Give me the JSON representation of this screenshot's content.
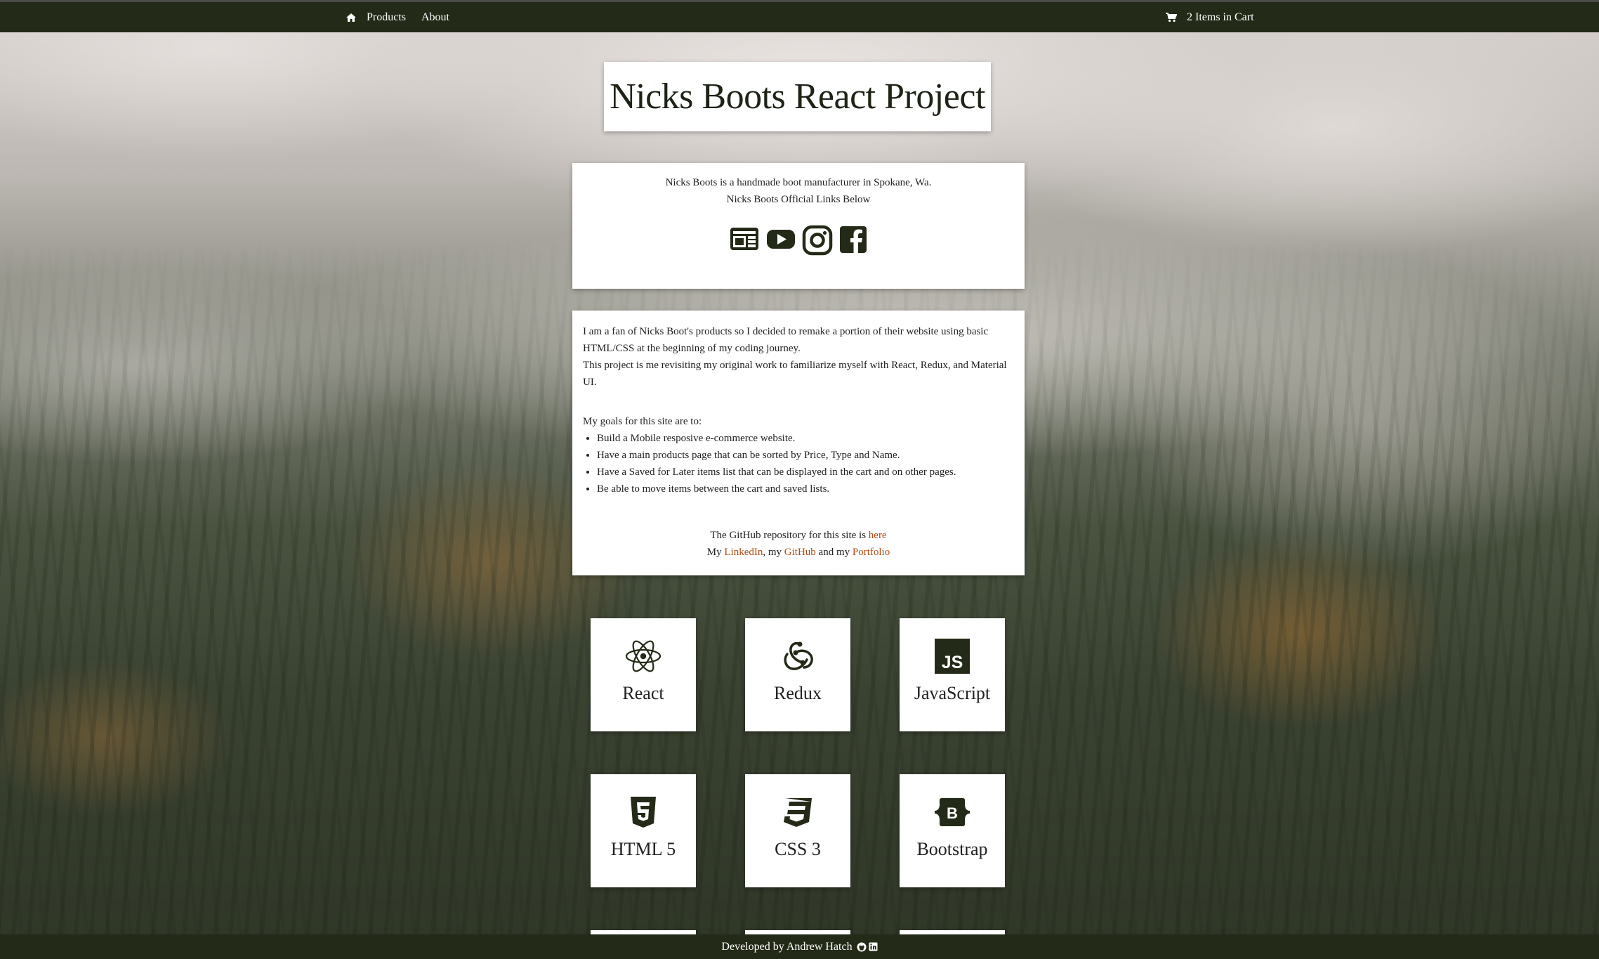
{
  "nav": {
    "home_icon": "home-icon",
    "items": [
      {
        "label": "Products"
      },
      {
        "label": "About"
      }
    ],
    "cart_icon": "shopping-cart-icon",
    "cart_label": "2 Items in Cart"
  },
  "header": {
    "title": "Nicks Boots React Project"
  },
  "intro": {
    "line1": "Nicks Boots is a handmade boot manufacturer in Spokane, Wa.",
    "line2": "Nicks Boots Official Links Below",
    "social_icons": [
      "website-icon",
      "youtube-icon",
      "instagram-icon",
      "facebook-icon"
    ]
  },
  "about": {
    "para1": "I am a fan of Nicks Boot's products so I decided to remake a portion of their website using basic HTML/CSS at the beginning of my coding journey.",
    "para2": "This project is me revisiting my original work to familiarize myself with React, Redux, and Material UI.",
    "goals_heading": "My goals for this site are to:",
    "goals": [
      "Build a Mobile resposive e-commerce website.",
      "Have a main products page that can be sorted by Price, Type and Name.",
      "Have a Saved for Later items list that can be displayed in the cart and on other pages.",
      "Be able to move items between the cart and saved lists."
    ],
    "repo_text": "The GitHub repository for this site is ",
    "repo_link": "here",
    "my_prefix": "My ",
    "linkedin": "LinkedIn",
    "comma_my": ", my ",
    "github": "GitHub",
    "and_my": " and my ",
    "portfolio": "Portfolio"
  },
  "tech": [
    {
      "label": "React",
      "icon": "react-icon"
    },
    {
      "label": "Redux",
      "icon": "redux-icon"
    },
    {
      "label": "JavaScript",
      "icon": "javascript-icon"
    },
    {
      "label": "HTML 5",
      "icon": "html5-icon"
    },
    {
      "label": "CSS 3",
      "icon": "css3-icon"
    },
    {
      "label": "Bootstrap",
      "icon": "bootstrap-icon"
    }
  ],
  "footer": {
    "text": "Developed by Andrew Hatch",
    "icons": [
      "github-icon",
      "linkedin-icon"
    ]
  },
  "colors": {
    "nav_bg": "#232a17",
    "link": "#b04e14",
    "icon_dark": "#232a17"
  }
}
